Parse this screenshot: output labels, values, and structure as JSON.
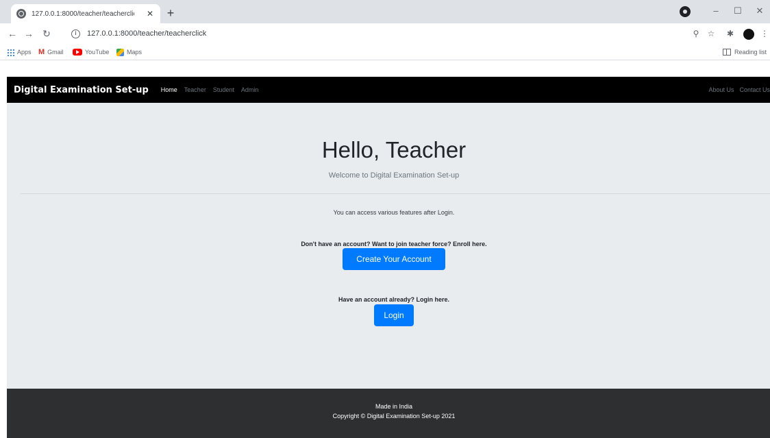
{
  "browser": {
    "tab_title": "127.0.0.1:8000/teacher/teacherclick",
    "tab_close": "✕",
    "new_tab": "+",
    "url": "127.0.0.1:8000/teacher/teacherclick",
    "window_minimize": "–",
    "window_maximize": "☐",
    "window_close": "✕",
    "bookmarks": [
      "Apps",
      "Gmail",
      "YouTube",
      "Maps"
    ],
    "reading_list": "Reading list"
  },
  "navbar": {
    "brand": "Digital Examination Set-up",
    "links": [
      "Home",
      "Teacher",
      "Student",
      "Admin"
    ],
    "right_links": [
      "About Us",
      "Contact Us"
    ]
  },
  "main": {
    "title": "Hello, Teacher",
    "subtitle": "Welcome to Digital Examination Set-up",
    "lead": "You can access various features after Login.",
    "signup_prompt": "Don't have an account? Want to join teacher force? Enroll here.",
    "signup_button": "Create Your Account",
    "login_prompt": "Have an account already? Login here.",
    "login_button": "Login"
  },
  "footer": {
    "line1": "Made in India",
    "line2": "Copyright © Digital Examination Set-up 2021"
  },
  "colors": {
    "primary": "#007bff",
    "navbar": "#000000",
    "footer": "#2d2f31",
    "page_bg": "#e9ecef"
  }
}
